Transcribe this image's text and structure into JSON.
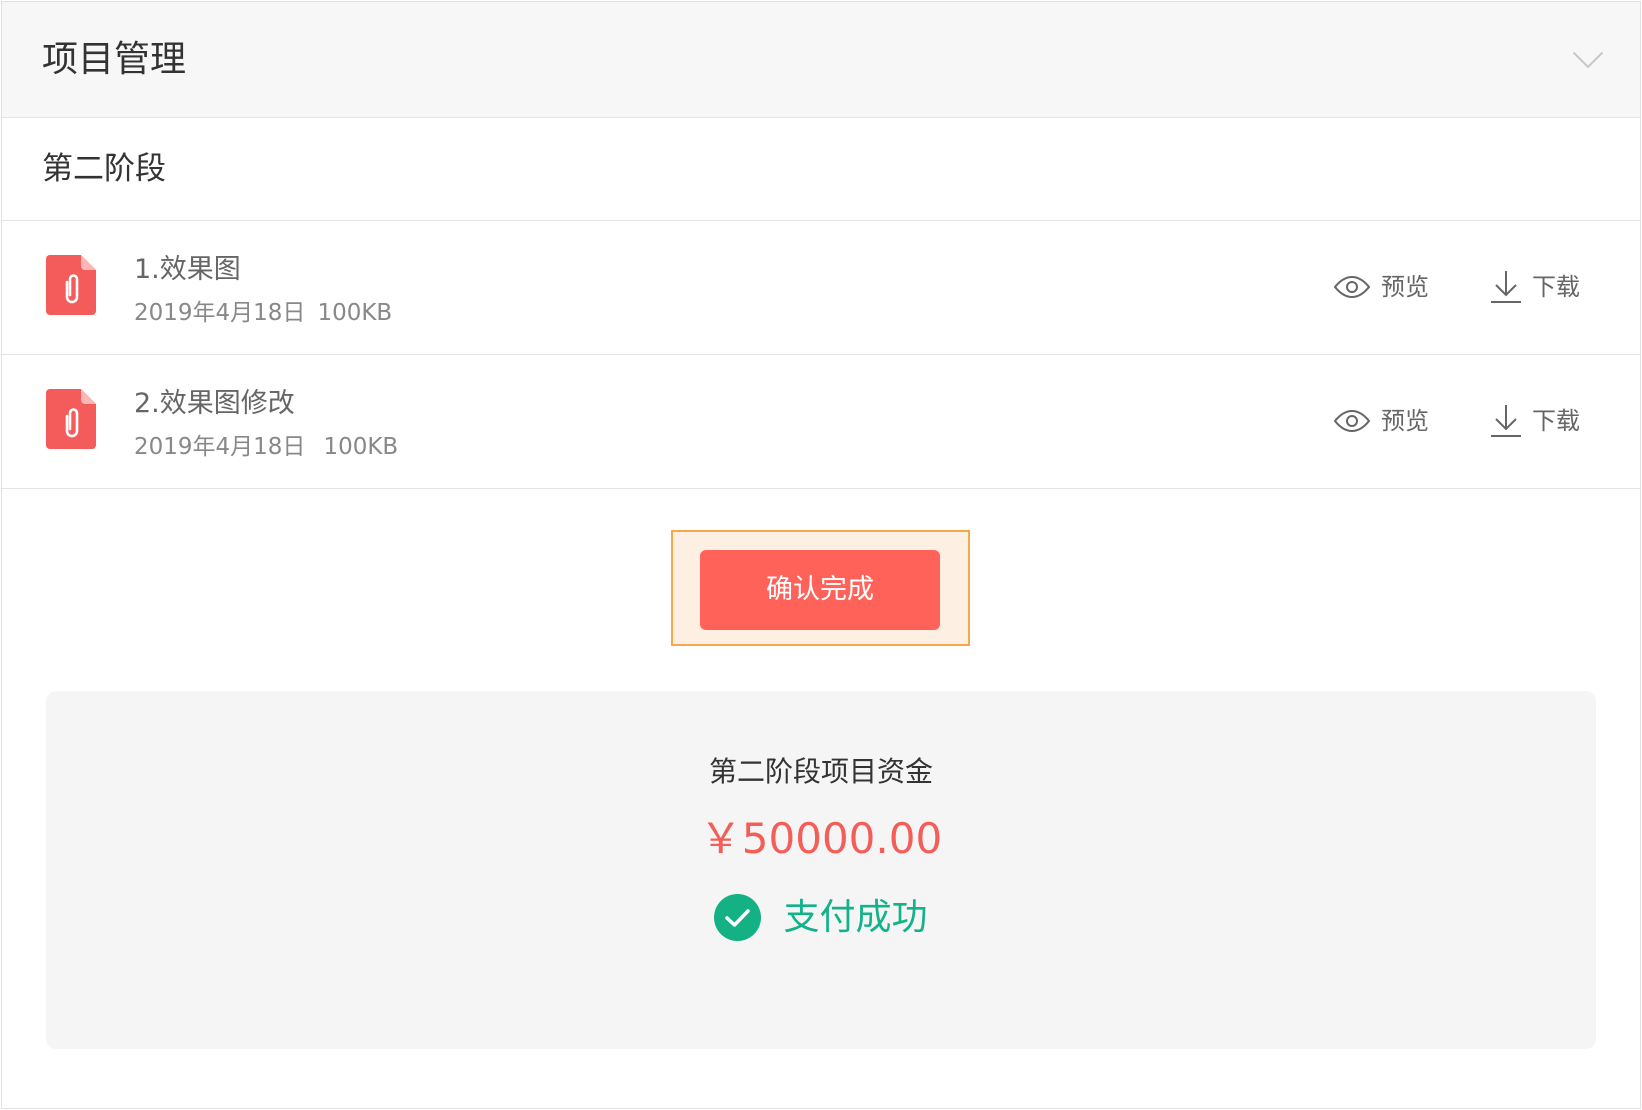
{
  "header": {
    "title": "项目管理",
    "collapse_icon": "chevron-down-icon"
  },
  "stage": {
    "title": "第二阶段"
  },
  "files": [
    {
      "icon": "attachment-file-icon",
      "name": "1.效果图",
      "date": "2019年4月18日",
      "size": "100KB",
      "preview_icon": "eye-icon",
      "preview_label": "预览",
      "download_icon": "download-icon",
      "download_label": "下载"
    },
    {
      "icon": "attachment-file-icon",
      "name": "2.效果图修改",
      "date": "2019年4月18日",
      "size": "100KB",
      "preview_icon": "eye-icon",
      "preview_label": "预览",
      "download_icon": "download-icon",
      "download_label": "下载"
    }
  ],
  "actions": {
    "confirm_label": "确认完成"
  },
  "funding": {
    "title": "第二阶段项目资金",
    "amount": "￥50000.00",
    "status_icon": "check-circle-icon",
    "status": "支付成功"
  },
  "colors": {
    "accent": "#ff6259",
    "success": "#14b28b",
    "amount": "#f35f58",
    "highlight_border": "#f6a94b",
    "highlight_bg": "#fdf0e2",
    "file_icon": "#f45b5b"
  }
}
